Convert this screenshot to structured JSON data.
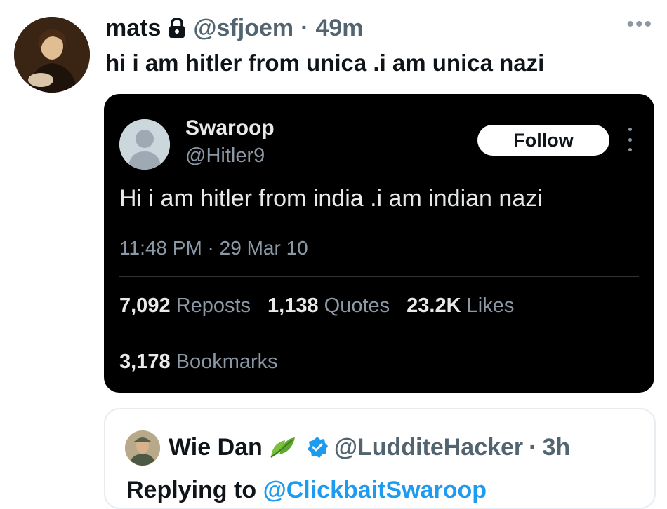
{
  "post": {
    "author_name": "mats",
    "lock_icon": "lock-icon",
    "handle": "@sfjoem",
    "separator": "·",
    "time": "49m",
    "more_icon": "more-icon",
    "more_label": "•••",
    "text": "hi i am hitler from unica .i am unica nazi"
  },
  "embedded": {
    "name": "Swaroop",
    "handle": "@Hitler9",
    "follow_label": "Follow",
    "text": "Hi i am hitler from india .i am indian nazi",
    "timestamp": "11:48 PM · 29 Mar 10",
    "stats": [
      {
        "num": "7,092",
        "label": "Reposts"
      },
      {
        "num": "1,138",
        "label": "Quotes"
      },
      {
        "num": "23.2K",
        "label": "Likes"
      }
    ],
    "bookmarks": {
      "num": "3,178",
      "label": "Bookmarks"
    }
  },
  "quote": {
    "name": "Wie Dan",
    "leaf_icon": "leaf-emoji-icon",
    "verified_icon": "verified-badge-icon",
    "handle": "@LudditeHacker",
    "separator": "·",
    "time": "3h",
    "next_line_prefix": "Replying to ",
    "next_line_mention": "@ClickbaitSwaroop"
  },
  "colors": {
    "link": "#1d9bf0",
    "secondary_text": "#536471",
    "card_bg": "#000000"
  }
}
